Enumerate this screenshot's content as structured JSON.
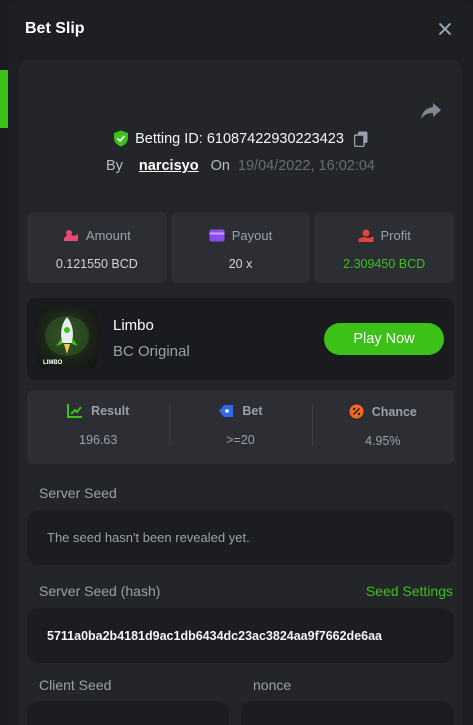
{
  "header": {
    "title": "Bet Slip"
  },
  "bet": {
    "id_label": "Betting ID:",
    "id_value": "61087422930223423",
    "by_label": "By",
    "user": "narcisyo",
    "on_label": "On",
    "date": "19/04/2022, 16:02:04"
  },
  "stats": [
    {
      "label": "Amount",
      "value": "0.121550 BCD"
    },
    {
      "label": "Payout",
      "value": "20 x"
    },
    {
      "label": "Profit",
      "value": "2.309450 BCD"
    }
  ],
  "game": {
    "name": "Limbo",
    "provider": "BC Original",
    "thumb_text": "LIMBO",
    "play_label": "Play Now"
  },
  "result": [
    {
      "label": "Result",
      "value": "196.63"
    },
    {
      "label": "Bet",
      "value": ">=20"
    },
    {
      "label": "Chance",
      "value": "4.95%"
    }
  ],
  "server_seed": {
    "label": "Server Seed",
    "value": "The seed hasn't been revealed yet."
  },
  "server_seed_hash": {
    "label": "Server Seed (hash)",
    "settings_label": "Seed Settings",
    "value": "5711a0ba2b4181d9ac1db6434dc23ac3824aa9f7662de6aa"
  },
  "client_seed": {
    "label": "Client Seed"
  },
  "nonce": {
    "label": "nonce"
  },
  "colors": {
    "accent_green": "#3bc117",
    "panel": "#232529",
    "card": "#2c2e33",
    "modal": "#1e1f22",
    "amount_icon": "#e84a74",
    "payout_icon": "#8a4cf0",
    "profit_icon": "#e8423c",
    "result_icon": "#3bc117",
    "bet_icon": "#2f6be8",
    "chance_icon": "#f26a21"
  },
  "icons": {
    "close": "close-icon",
    "share": "share-icon",
    "shield": "shield-check-icon",
    "copy": "copy-icon",
    "amount": "money-hand-icon",
    "payout": "wallet-icon",
    "profit": "profit-hand-icon",
    "result": "chart-up-icon",
    "bet": "tag-icon",
    "chance": "percent-icon"
  }
}
